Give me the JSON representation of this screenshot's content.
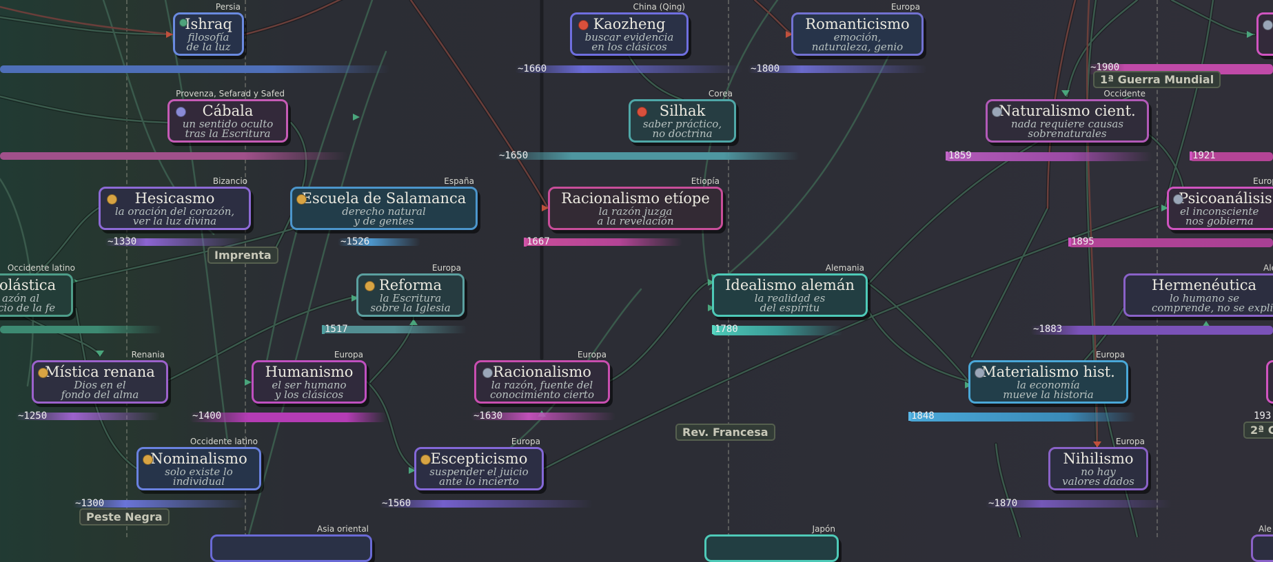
{
  "nodes": [
    {
      "id": "ishraq",
      "title": "Ishraq",
      "sub1": "filosofía",
      "sub2": "de la luz",
      "region": "Persia",
      "color": "#6a8ae0",
      "dot": "#4fa27c",
      "year": ""
    },
    {
      "id": "cabala",
      "title": "Cábala",
      "sub1": "un sentido oculto",
      "sub2": "tras la Escritura",
      "region": "Provenza, Sefarad y Safed",
      "color": "#c65bb6",
      "dot": "#8a8ad6",
      "year": ""
    },
    {
      "id": "hesicasmo",
      "title": "Hesicasmo",
      "sub1": "la oración del corazón,",
      "sub2": "ver la luz divina",
      "region": "Bizancio",
      "color": "#8d6ad6",
      "dot": "#d8a443",
      "year": "~1330"
    },
    {
      "id": "salamanca",
      "title": "Escuela de Salamanca",
      "sub1": "derecho natural",
      "sub2": "y de gentes",
      "region": "España",
      "color": "#4c96cc",
      "dot": "#d8a443",
      "year": "~1526"
    },
    {
      "id": "escolastica",
      "title": "olástica",
      "sub1": "azón al",
      "sub2": "cio de la fe",
      "region": "Occidente latino",
      "color": "#4e9e8a",
      "dot": "",
      "year": ""
    },
    {
      "id": "reforma",
      "title": "Reforma",
      "sub1": "la Escritura",
      "sub2": "sobre la Iglesia",
      "region": "Europa",
      "color": "#5ba0a0",
      "dot": "#d8a443",
      "year": "1517"
    },
    {
      "id": "mistica",
      "title": "Mística renana",
      "sub1": "Dios en el",
      "sub2": "fondo del alma",
      "region": "Renania",
      "color": "#9c62cc",
      "dot": "#d8a443",
      "year": "~1250"
    },
    {
      "id": "humanismo",
      "title": "Humanismo",
      "sub1": "el ser humano",
      "sub2": "y los clásicos",
      "region": "Europa",
      "color": "#c050c0",
      "dot": "",
      "year": "~1400"
    },
    {
      "id": "nominalismo",
      "title": "Nominalismo",
      "sub1": "solo existe lo",
      "sub2": "individual",
      "region": "Occidente latino",
      "color": "#6a82e0",
      "dot": "#d8a443",
      "year": "~1300"
    },
    {
      "id": "kaozheng",
      "title": "Kaozheng",
      "sub1": "buscar evidencia",
      "sub2": "en los clásicos",
      "region": "China (Qing)",
      "color": "#6f6fe0",
      "dot": "#d9503c",
      "year": "~1660"
    },
    {
      "id": "silhak",
      "title": "Silhak",
      "sub1": "saber práctico,",
      "sub2": "no doctrina",
      "region": "Corea",
      "color": "#4fa8a8",
      "dot": "#d9503c",
      "year": "~1650"
    },
    {
      "id": "etiope",
      "title": "Racionalismo etíope",
      "sub1": "la razón juzga",
      "sub2": "a la revelación",
      "region": "Etiopía",
      "color": "#c94e9a",
      "dot": "",
      "year": "1667"
    },
    {
      "id": "racionalismo",
      "title": "Racionalismo",
      "sub1": "la razón, fuente del",
      "sub2": "conocimiento cierto",
      "region": "Europa",
      "color": "#c94eb0",
      "dot": "#9aa6b8",
      "year": "~1630"
    },
    {
      "id": "escepticismo",
      "title": "Escepticismo",
      "sub1": "suspender el juicio",
      "sub2": "ante lo incierto",
      "region": "Europa",
      "color": "#8468d8",
      "dot": "#d8a443",
      "year": "~1560"
    },
    {
      "id": "romanticismo",
      "title": "Romanticismo",
      "sub1": "emoción,",
      "sub2": "naturaleza, genio",
      "region": "Europa",
      "color": "#7272d2",
      "dot": "",
      "year": "~1800"
    },
    {
      "id": "idealismo",
      "title": "Idealismo alemán",
      "sub1": "la realidad es",
      "sub2": "del espíritu",
      "region": "Alemania",
      "color": "#4ecab8",
      "dot": "",
      "year": "1780"
    },
    {
      "id": "naturalismo",
      "title": "Naturalismo cient.",
      "sub1": "nada requiere causas",
      "sub2": "sobrenaturales",
      "region": "Occidente",
      "color": "#b25ab8",
      "dot": "#9aa6b8",
      "year": "1859"
    },
    {
      "id": "psicoanalisis",
      "title": "Psicoanálisis",
      "sub1": "el inconsciente",
      "sub2": "nos gobierna",
      "region": "Europa",
      "color": "#d054c0",
      "dot": "#9aa6b8",
      "year": "1895"
    },
    {
      "id": "hermeneutica",
      "title": "Hermenéutica",
      "sub1": "lo humano se",
      "sub2": "comprende, no se explica",
      "region": "Alemania",
      "color": "#8a62c8",
      "dot": "",
      "year": "~1883"
    },
    {
      "id": "materialismo",
      "title": "Materialismo hist.",
      "sub1": "la economía",
      "sub2": "mueve la historia",
      "region": "Europa",
      "color": "#4aa8d8",
      "dot": "#9aa6b8",
      "year": "1848"
    },
    {
      "id": "nihilismo",
      "title": "Nihilismo",
      "sub1": "no hay",
      "sub2": "valores dados",
      "region": "Europa",
      "color": "#8a62c8",
      "dot": "",
      "year": "~1870"
    }
  ],
  "extra_years": [
    "~1900",
    "1921",
    "193"
  ],
  "events": [
    "Imprenta",
    "Peste Negra",
    "Rev. Francesa",
    "1ª Guerra Mundial",
    "2ª G"
  ],
  "bottom_regions": [
    "Asia oriental",
    "Japón",
    "Ale"
  ]
}
